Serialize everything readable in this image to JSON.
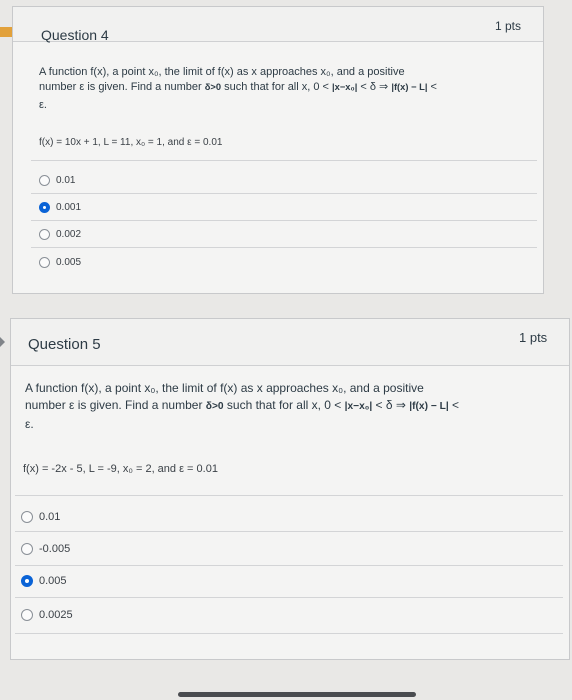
{
  "questions": [
    {
      "title": "Question 4",
      "points": "1 pts",
      "prompt_line1": "A function f(x), a point x₀, the limit of f(x) as x approaches x₀, and a positive",
      "prompt_line2_a": "number ε is given. Find a number ",
      "prompt_delta": "δ>0",
      "prompt_line2_b": " such that for all x, 0 < ",
      "prompt_abs1": "|x−x₀|",
      "prompt_line2_c": " < δ ⇒ ",
      "prompt_abs2": "|f(x) − L|",
      "prompt_line2_d": " <",
      "prompt_line3": "ε.",
      "given": "f(x) = 10x + 1, L = 11, x₀ = 1, and ε = 0.01",
      "options": [
        "0.01",
        "0.001",
        "0.002",
        "0.005"
      ],
      "selected_index": 1
    },
    {
      "title": "Question 5",
      "points": "1 pts",
      "prompt_line1": "A function f(x), a point x₀, the limit of f(x) as x approaches x₀, and a positive",
      "prompt_line2_a": "number ε is given. Find a number ",
      "prompt_delta": "δ>0",
      "prompt_line2_b": " such that for all x, 0 < ",
      "prompt_abs1": "|x−x₀|",
      "prompt_line2_c": " < δ ⇒ ",
      "prompt_abs2": "|f(x) − L|",
      "prompt_line2_d": " <",
      "prompt_line3": "ε.",
      "given": "f(x) = -2x - 5, L = -9, x₀ = 2, and ε = 0.01",
      "options": [
        "0.01",
        "-0.005",
        "0.005",
        "0.0025"
      ],
      "selected_index": 2
    }
  ],
  "icons": {
    "flag": "flag-icon",
    "collapse": "caret-right-icon"
  },
  "colors": {
    "accent": "#0a63d6",
    "flag": "#e2a13b"
  }
}
